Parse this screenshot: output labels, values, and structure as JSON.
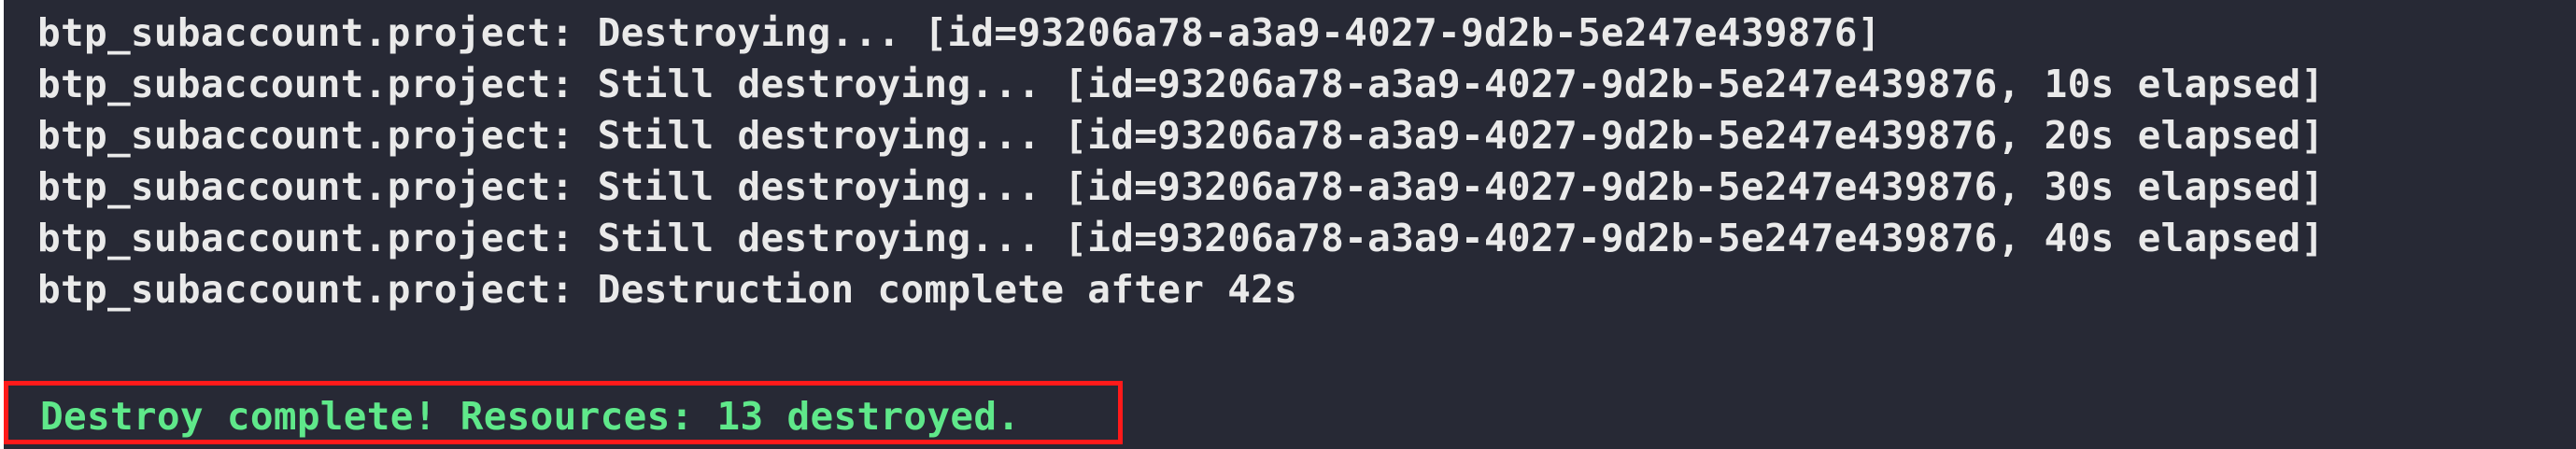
{
  "terminal": {
    "lines": [
      "btp_subaccount.project: Destroying... [id=93206a78-a3a9-4027-9d2b-5e247e439876]",
      "btp_subaccount.project: Still destroying... [id=93206a78-a3a9-4027-9d2b-5e247e439876, 10s elapsed]",
      "btp_subaccount.project: Still destroying... [id=93206a78-a3a9-4027-9d2b-5e247e439876, 20s elapsed]",
      "btp_subaccount.project: Still destroying... [id=93206a78-a3a9-4027-9d2b-5e247e439876, 30s elapsed]",
      "btp_subaccount.project: Still destroying... [id=93206a78-a3a9-4027-9d2b-5e247e439876, 40s elapsed]",
      "btp_subaccount.project: Destruction complete after 42s"
    ],
    "result": "Destroy complete! Resources: 13 destroyed."
  },
  "colors": {
    "background": "#272935",
    "text": "#eaeaea",
    "success": "#5fe88a",
    "highlight_border": "#ff1a1a"
  }
}
